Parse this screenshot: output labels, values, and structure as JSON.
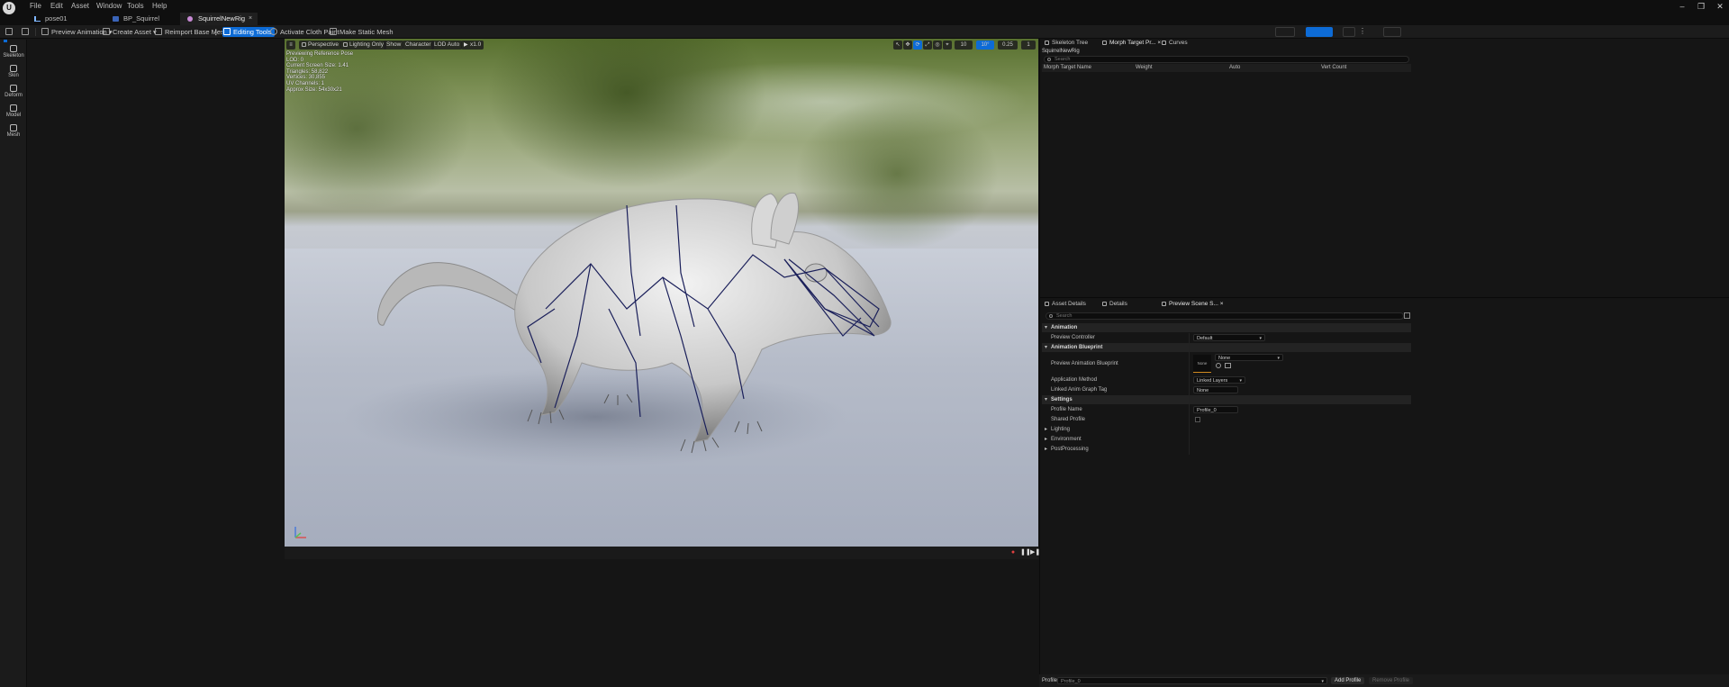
{
  "menu": {
    "items": [
      "File",
      "Edit",
      "Asset",
      "Window",
      "Tools",
      "Help"
    ]
  },
  "tabs": [
    {
      "label": "pose01",
      "active": false
    },
    {
      "label": "BP_Squirrel",
      "active": false
    },
    {
      "label": "SquirrelNewRig",
      "active": true
    }
  ],
  "toolbar": {
    "preview_animation": "Preview Animation",
    "create_asset": "Create Asset",
    "reimport": "Reimport Base Mesh",
    "editing_tools": "Editing Tools",
    "activate_cloth_paint": "Activate Cloth Paint",
    "make_static_mesh": "Make Static Mesh"
  },
  "modes": [
    "Skeleton",
    "Skin",
    "Deform",
    "Model",
    "Mesh"
  ],
  "viewport": {
    "buttons": {
      "perspective": "Perspective",
      "lighting": "Lighting Only",
      "show": "Show",
      "character": "Character",
      "lod": "LOD Auto",
      "speed": "x1.0"
    },
    "right_values": {
      "grid": "10",
      "angle": "10°",
      "scale": "0.25",
      "camera": "1"
    },
    "info": [
      "Previewing Reference Pose",
      "LOD: 0",
      "Current Screen Size: 1.41",
      "Triangles: 58,822",
      "Vertices: 30,855",
      "UV Channels: 1",
      "Approx Size: 54x30x21"
    ]
  },
  "right": {
    "top_tabs": [
      "Skeleton Tree",
      "Morph Target Pr...",
      "Curves"
    ],
    "asset_name": "SquirrelNewRig",
    "search_placeholder": "Search",
    "morph_columns": [
      "Morph Target Name",
      "Weight",
      "Auto",
      "Vert Count"
    ],
    "bottom_tabs": [
      "Asset Details",
      "Details",
      "Preview Scene S..."
    ],
    "sections": {
      "animation": "Animation",
      "animation_blueprint": "Animation Blueprint",
      "settings": "Settings",
      "lighting": "Lighting",
      "environment": "Environment",
      "postprocessing": "PostProcessing"
    },
    "props": {
      "preview_controller_label": "Preview Controller",
      "preview_controller_value": "Default",
      "preview_anim_bp_label": "Preview Animation Blueprint",
      "preview_anim_bp_thumb": "None",
      "preview_anim_bp_value": "None",
      "application_method_label": "Application Method",
      "application_method_value": "Linked Layers",
      "linked_anim_tag_label": "Linked Anim Graph Tag",
      "linked_anim_tag_value": "None",
      "profile_name_label": "Profile Name",
      "profile_name_value": "Profile_0",
      "shared_profile_label": "Shared Profile"
    },
    "profile_bar": {
      "label": "Profile",
      "value": "Profile_0",
      "add": "Add Profile",
      "remove": "Remove Profile"
    }
  },
  "colors": {
    "accent": "#0d6bd6",
    "background": "#151515",
    "panel": "#1c1c1c"
  }
}
